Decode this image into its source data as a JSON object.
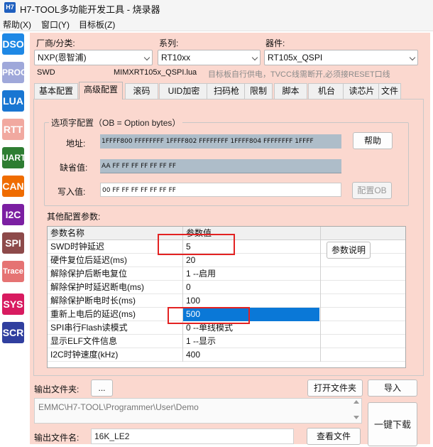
{
  "window": {
    "app_icon": "H7",
    "title": "H7-TOOL多功能开发工具 - 烧录器"
  },
  "menu": [
    "帮助(X)",
    "窗口(Y)",
    "目标板(Z)"
  ],
  "sidebar": [
    {
      "label": "DSO",
      "color": "#1e88e5"
    },
    {
      "label": "PROG",
      "color": "#9fa8da"
    },
    {
      "label": "LUA",
      "color": "#1976d2"
    },
    {
      "label": "RTT",
      "color": "#f1a9a0"
    },
    {
      "label": "UART",
      "color": "#2e7d32"
    },
    {
      "label": "CAN",
      "color": "#ef6c00"
    },
    {
      "label": "I2C",
      "color": "#7b1fa2"
    },
    {
      "label": "SPI",
      "color": "#8d4a4a"
    },
    {
      "label": "Trace",
      "color": "#e57373"
    },
    {
      "label": "SYS",
      "color": "#d81b60"
    },
    {
      "label": "SCR",
      "color": "#303f9f"
    }
  ],
  "selectors": {
    "vendor_label": "厂商/分类:",
    "vendor_value": "NXP(恩智浦)",
    "series_label": "系列:",
    "series_value": "RT10xx",
    "device_label": "器件:",
    "device_value": "RT105x_QSPI"
  },
  "info": {
    "interface": "SWD",
    "lua_file": "MIMXRT105x_QSPI.lua",
    "hint": "目标板自行供电，TVCC线需断开,必须接RESET口线"
  },
  "tabs": [
    "基本配置",
    "高级配置",
    "滚码",
    "UID加密",
    "扫码枪",
    "限制",
    "脚本",
    "机台",
    "读芯片",
    "文件"
  ],
  "option_bytes": {
    "group_title": "选项字配置（OB = Option bytes）",
    "address_label": "地址:",
    "address_value": "1FFFF800 FFFFFFFF 1FFFF802 FFFFFFFF 1FFFF804 FFFFFFFF 1FFFF",
    "default_label": "缺省值:",
    "default_value": "AA FF FF FF FF FF FF FF",
    "write_label": "写入值:",
    "write_value": "00 FF FF FF FF FF FF FF",
    "help_button": "帮助",
    "config_button": "配置OB"
  },
  "params": {
    "section_label": "其他配置参数:",
    "col_name": "参数名称",
    "col_value": "参数值",
    "explain_button": "参数说明",
    "selected_index": 6,
    "rows": [
      {
        "name": "SWD时钟延迟",
        "value": "5"
      },
      {
        "name": "硬件复位后延迟(ms)",
        "value": "20"
      },
      {
        "name": "解除保护后断电复位",
        "value": "1 --启用"
      },
      {
        "name": "解除保护时延迟断电(ms)",
        "value": "0"
      },
      {
        "name": "解除保护断电时长(ms)",
        "value": "100"
      },
      {
        "name": "重新上电后的延迟(ms)",
        "value": "500"
      },
      {
        "name": "SPI串行Flash读模式",
        "value": "0 --单线模式"
      },
      {
        "name": "显示ELF文件信息",
        "value": "1 --显示"
      },
      {
        "name": "I2C时钟速度(kHz)",
        "value": "400"
      }
    ]
  },
  "bottom": {
    "output_folder_label": "输出文件夹:",
    "browse_button": "...",
    "open_folder_button": "打开文件夹",
    "import_button": "导入",
    "path": "EMMC\\H7-TOOL\\Programmer\\User\\Demo",
    "output_name_label": "输出文件名:",
    "output_name_value": "16K_LE2",
    "view_file_button": "查看文件",
    "download_button": "一键下载"
  }
}
